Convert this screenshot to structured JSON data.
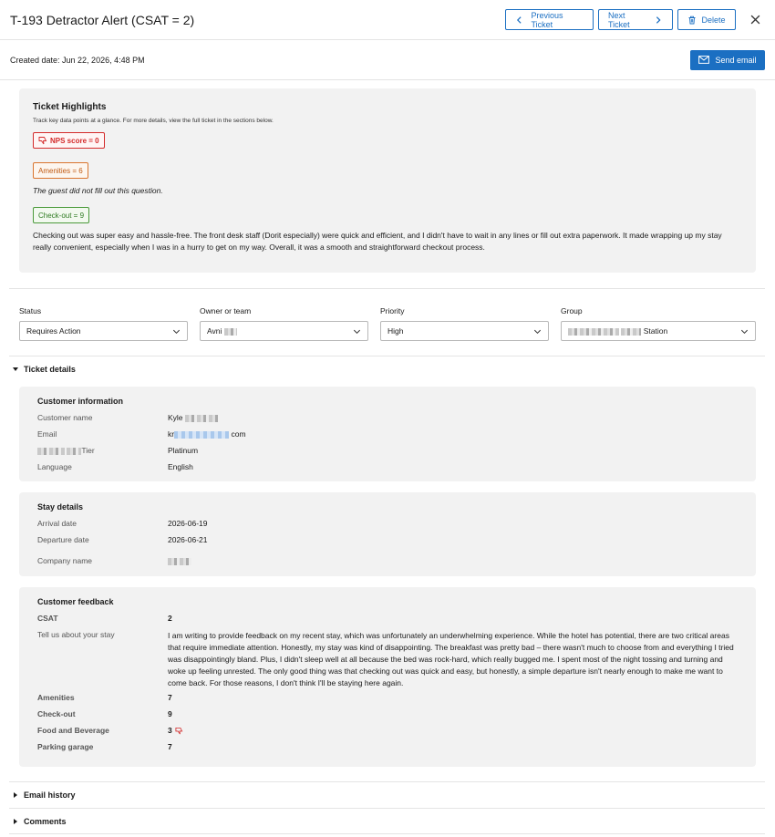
{
  "header": {
    "title": "T-193 Detractor Alert (CSAT = 2)",
    "prev_label": "Previous Ticket",
    "next_label": "Next Ticket",
    "delete_label": "Delete"
  },
  "subbar": {
    "created": "Created date: Jun 22, 2026, 4:48 PM",
    "send_email": "Send email"
  },
  "highlights": {
    "title": "Ticket Highlights",
    "subtitle": "Track key data points at a glance. For more details, view the full ticket in the sections below.",
    "nps_chip": "NPS score = 0",
    "amenities_chip": "Amenities = 6",
    "amenities_note": "The guest did not fill out this question.",
    "checkout_chip": "Check-out = 9",
    "checkout_text": "Checking out was super easy and hassle-free. The front desk staff (Dorit especially) were quick and efficient, and I didn't have to wait in any lines or fill out extra paperwork. It made wrapping up my stay really convenient, especially when I was in a hurry to get on my way. Overall, it was a smooth and straightforward checkout process."
  },
  "fields": {
    "status_label": "Status",
    "status_value": "Requires Action",
    "owner_label": "Owner or team",
    "owner_value": "Avni",
    "priority_label": "Priority",
    "priority_value": "High",
    "group_label": "Group",
    "group_value": "Station"
  },
  "sections": {
    "ticket_details": "Ticket details",
    "email_history": "Email history",
    "comments": "Comments"
  },
  "customer_info": {
    "title": "Customer information",
    "name_label": "Customer name",
    "name_value": "Kyle",
    "email_label": "Email",
    "email_prefix": "kr",
    "email_suffix": "com",
    "tier_label": "Tier",
    "tier_value": "Platinum",
    "language_label": "Language",
    "language_value": "English"
  },
  "stay_details": {
    "title": "Stay details",
    "arrival_label": "Arrival date",
    "arrival_value": "2026-06-19",
    "departure_label": "Departure date",
    "departure_value": "2026-06-21",
    "company_label": "Company name"
  },
  "feedback": {
    "title": "Customer feedback",
    "csat_label": "CSAT",
    "csat_value": "2",
    "stay_label": "Tell us about your stay",
    "stay_text": "I am writing to provide feedback on my recent stay, which was unfortunately an underwhelming experience. While the hotel has potential, there are two critical areas that require immediate attention. Honestly, my stay was kind of disappointing. The breakfast was pretty bad – there wasn't much to choose from and everything I tried was disappointingly bland. Plus, I didn't sleep well at all because the bed was rock-hard, which really bugged me. I spent most of the night tossing and turning and woke up feeling unrested. The only good thing was that checking out was quick and easy, but honestly, a simple departure isn't nearly enough to make me want to come back. For those reasons, I don't think I'll be staying here again.",
    "amenities_label": "Amenities",
    "amenities_value": "7",
    "checkout_label": "Check-out",
    "checkout_value": "9",
    "food_label": "Food and Beverage",
    "food_value": "3",
    "parking_label": "Parking garage",
    "parking_value": "7"
  },
  "colors": {
    "accent": "#1b6fc2",
    "detractor": "#d32a2a",
    "passive": "#c05a13",
    "promoter": "#2d7a20",
    "card_bg": "#f2f2f2"
  }
}
